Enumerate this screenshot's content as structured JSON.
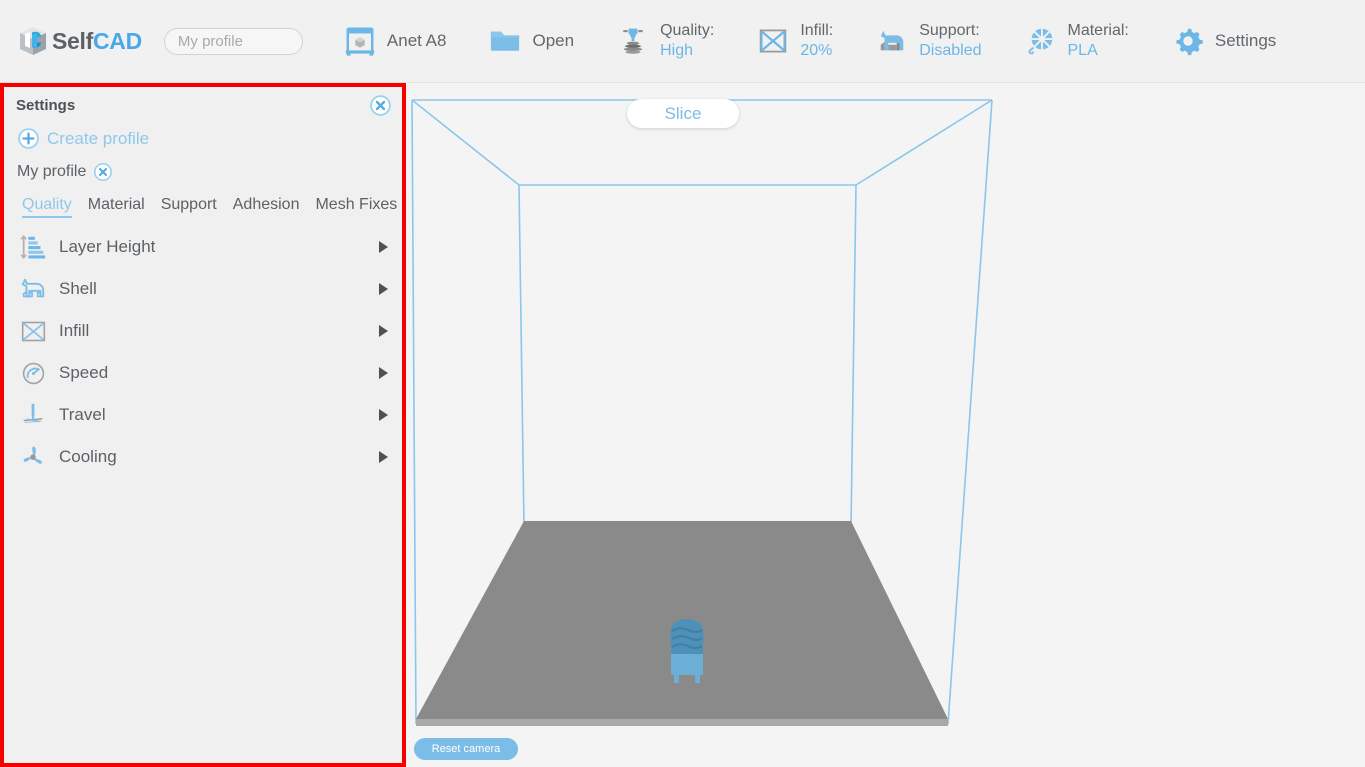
{
  "app": {
    "brand_self": "Self",
    "brand_cad": "CAD",
    "accent_blue": "#6cb6e8",
    "text_gray": "#5c6166",
    "panel_bg": "#f0f0f0",
    "highlight_border": "#f70000"
  },
  "toolbar": {
    "profile_input_value": "",
    "profile_input_placeholder": "My profile",
    "items": [
      {
        "icon": "printer-icon",
        "label": "Anet A8",
        "type": "single"
      },
      {
        "icon": "folder-icon",
        "label": "Open",
        "type": "single"
      },
      {
        "icon": "nozzle-icon",
        "key": "Quality:",
        "value": "High",
        "type": "stack"
      },
      {
        "icon": "infill-icon",
        "key": "Infill:",
        "value": "20%",
        "type": "stack"
      },
      {
        "icon": "support-icon",
        "key": "Support:",
        "value": "Disabled",
        "type": "stack"
      },
      {
        "icon": "material-icon",
        "key": "Material:",
        "value": "PLA",
        "type": "stack"
      },
      {
        "icon": "gear-icon",
        "label": "Settings",
        "type": "single"
      }
    ]
  },
  "settings_panel": {
    "title": "Settings",
    "close_icon": "close-circle-icon",
    "create_profile_label": "Create profile",
    "create_profile_icon": "plus-circle-icon",
    "profile_name": "My profile",
    "profile_remove_icon": "close-circle-icon",
    "tabs": [
      {
        "label": "Quality",
        "active": true
      },
      {
        "label": "Material",
        "active": false
      },
      {
        "label": "Support",
        "active": false
      },
      {
        "label": "Adhesion",
        "active": false
      },
      {
        "label": "Mesh Fixes",
        "active": false
      }
    ],
    "rows": [
      {
        "label": "Layer Height",
        "icon": "layer-height-icon",
        "arrow": "chevron-right-icon"
      },
      {
        "label": "Shell",
        "icon": "shell-dog-icon",
        "arrow": "chevron-right-icon"
      },
      {
        "label": "Infill",
        "icon": "infill-icon",
        "arrow": "chevron-right-icon"
      },
      {
        "label": "Speed",
        "icon": "speedometer-icon",
        "arrow": "chevron-right-icon"
      },
      {
        "label": "Travel",
        "icon": "travel-nozzle-icon",
        "arrow": "chevron-right-icon"
      },
      {
        "label": "Cooling",
        "icon": "fan-icon",
        "arrow": "chevron-right-icon"
      }
    ]
  },
  "viewport": {
    "slice_button_label": "Slice",
    "reset_camera_label": "Reset camera",
    "build_volume_color": "#8cc6ea",
    "build_plate_color": "#8a8a8a",
    "model_color": "#5b9dc4",
    "model_name": "3d-model-object"
  }
}
